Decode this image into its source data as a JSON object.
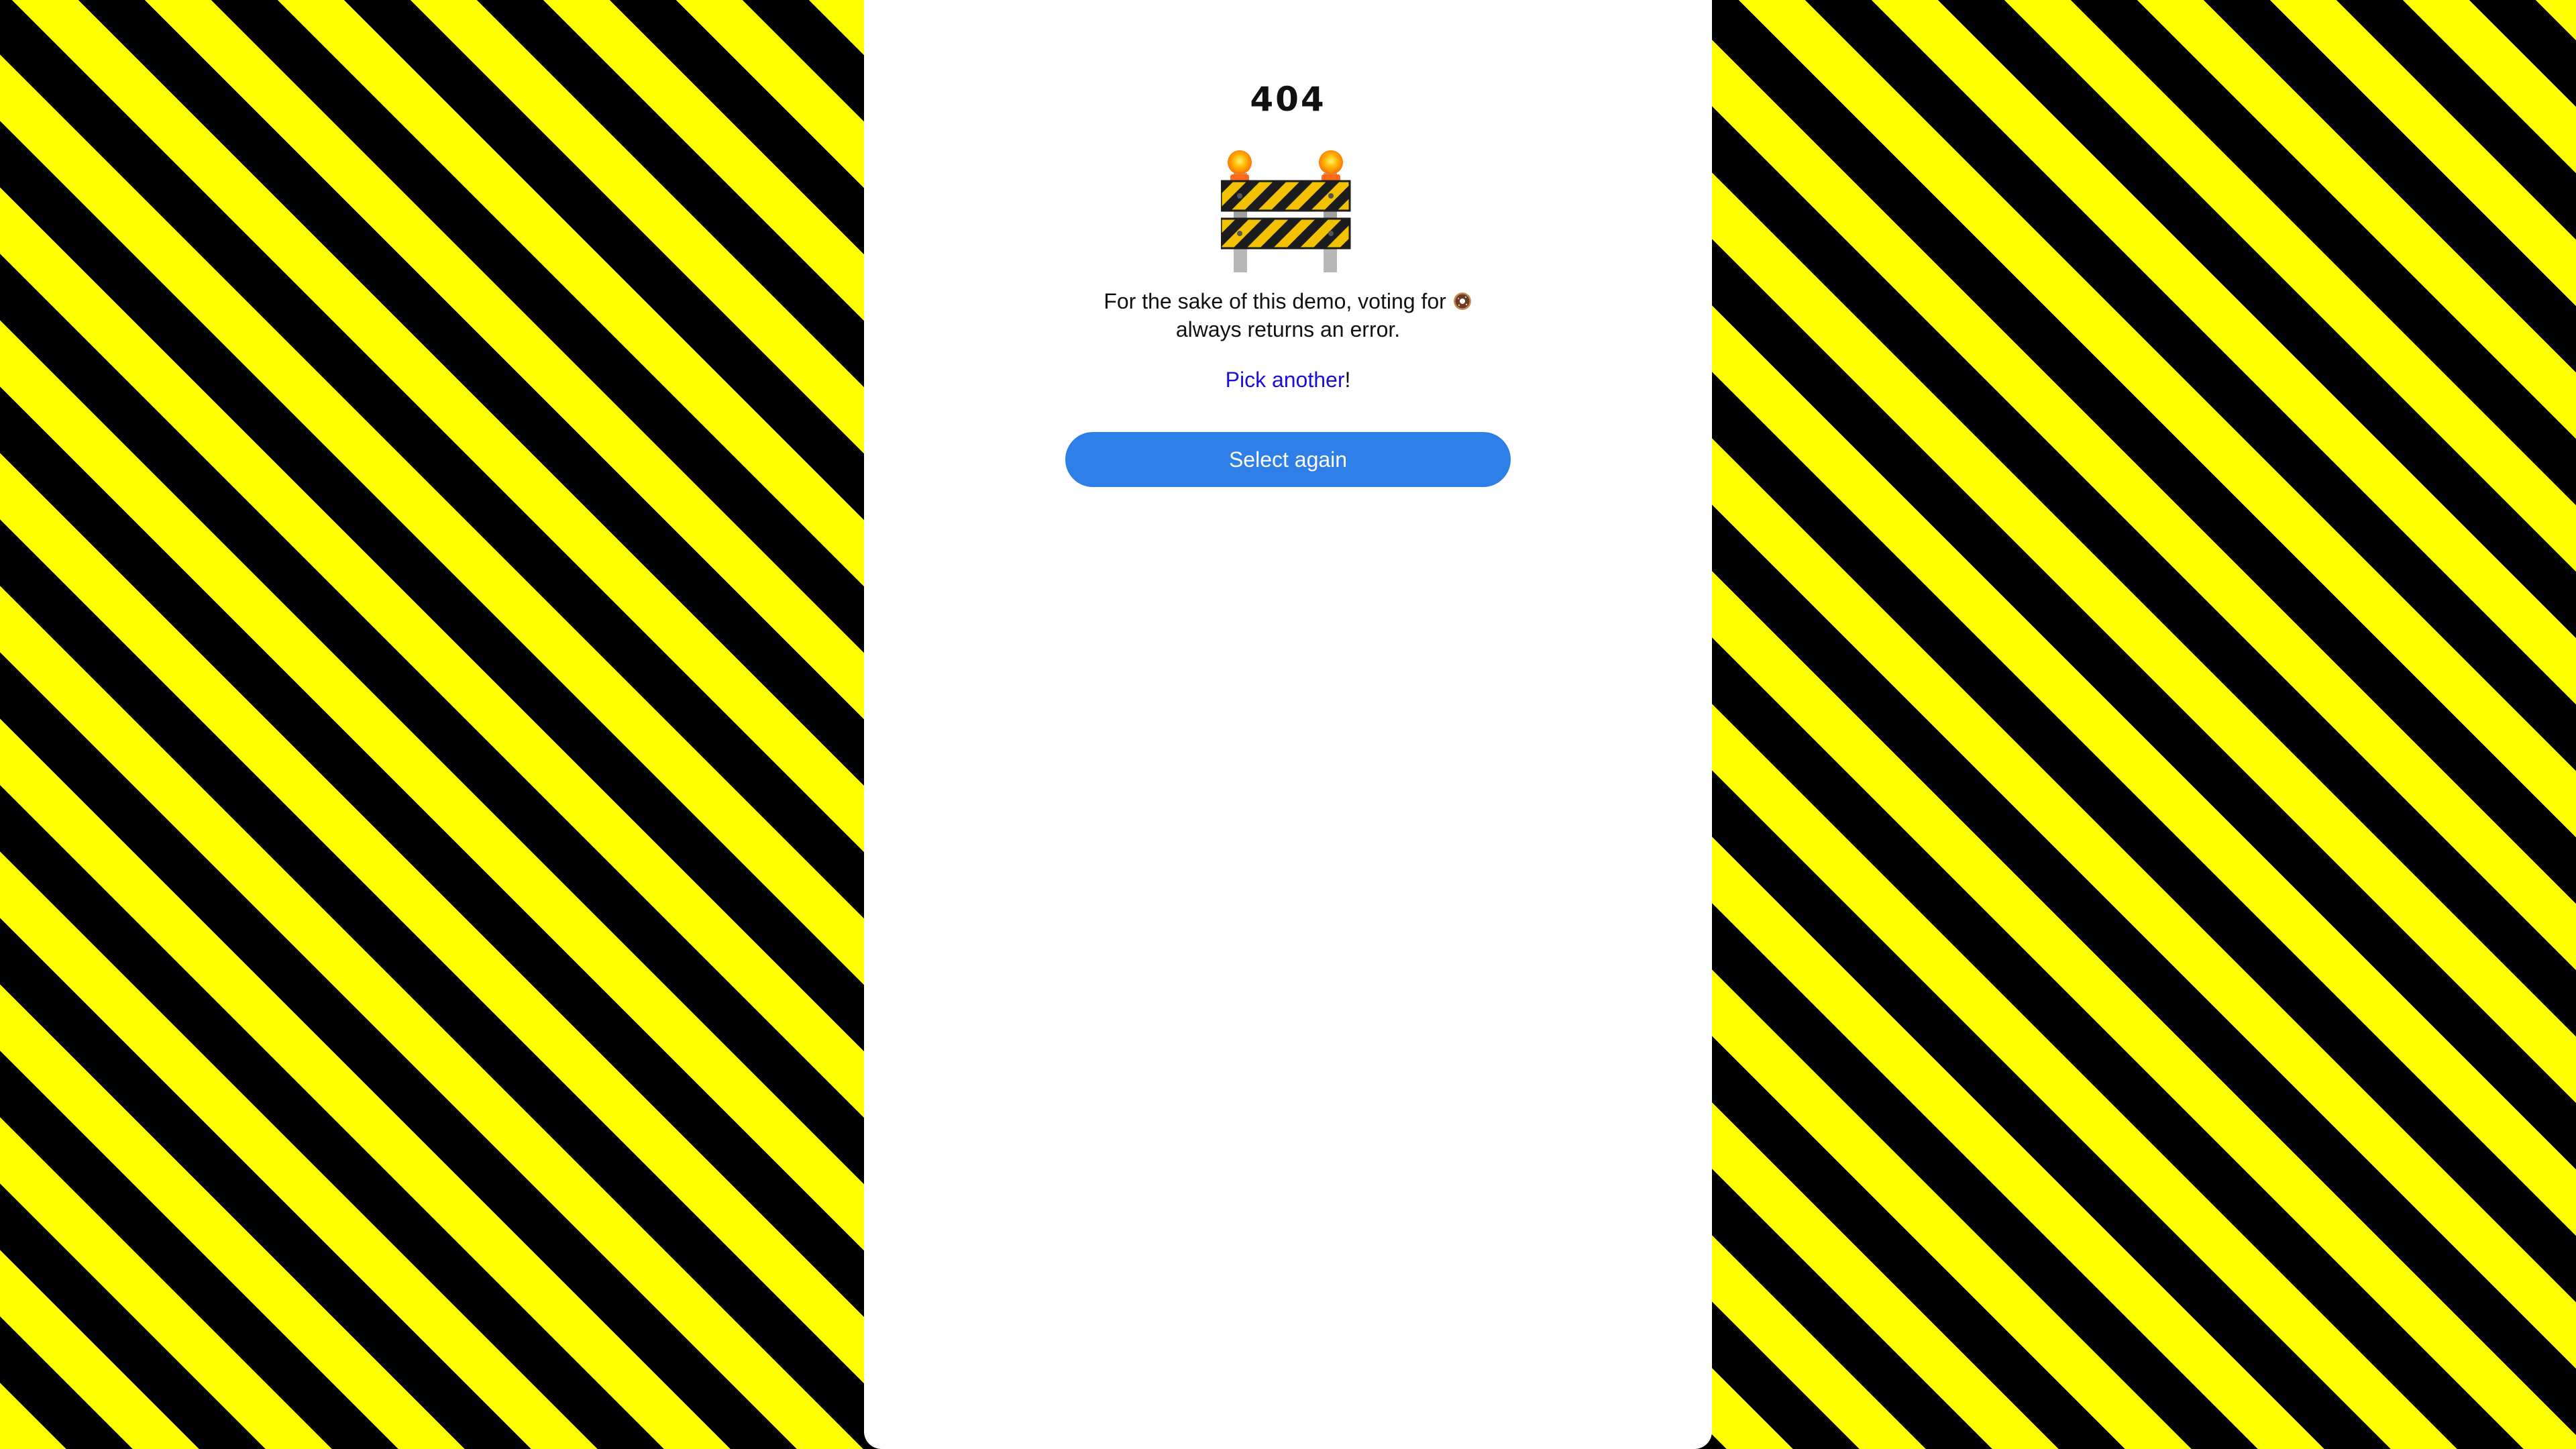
{
  "error": {
    "code": "404",
    "illustration_icon": "construction-barrier-icon",
    "message_before_icon": "For the sake of this demo, voting for",
    "message_icon": "donut-icon",
    "message_after_icon": "always returns an error.",
    "retry_link": "Pick another",
    "retry_suffix": "!",
    "button_label": "Select again"
  },
  "colors": {
    "stripe_yellow": "#ffff00",
    "stripe_black": "#000000",
    "card_background": "#ffffff",
    "button_background": "#2f7fe8",
    "link": "#1a10d8"
  }
}
